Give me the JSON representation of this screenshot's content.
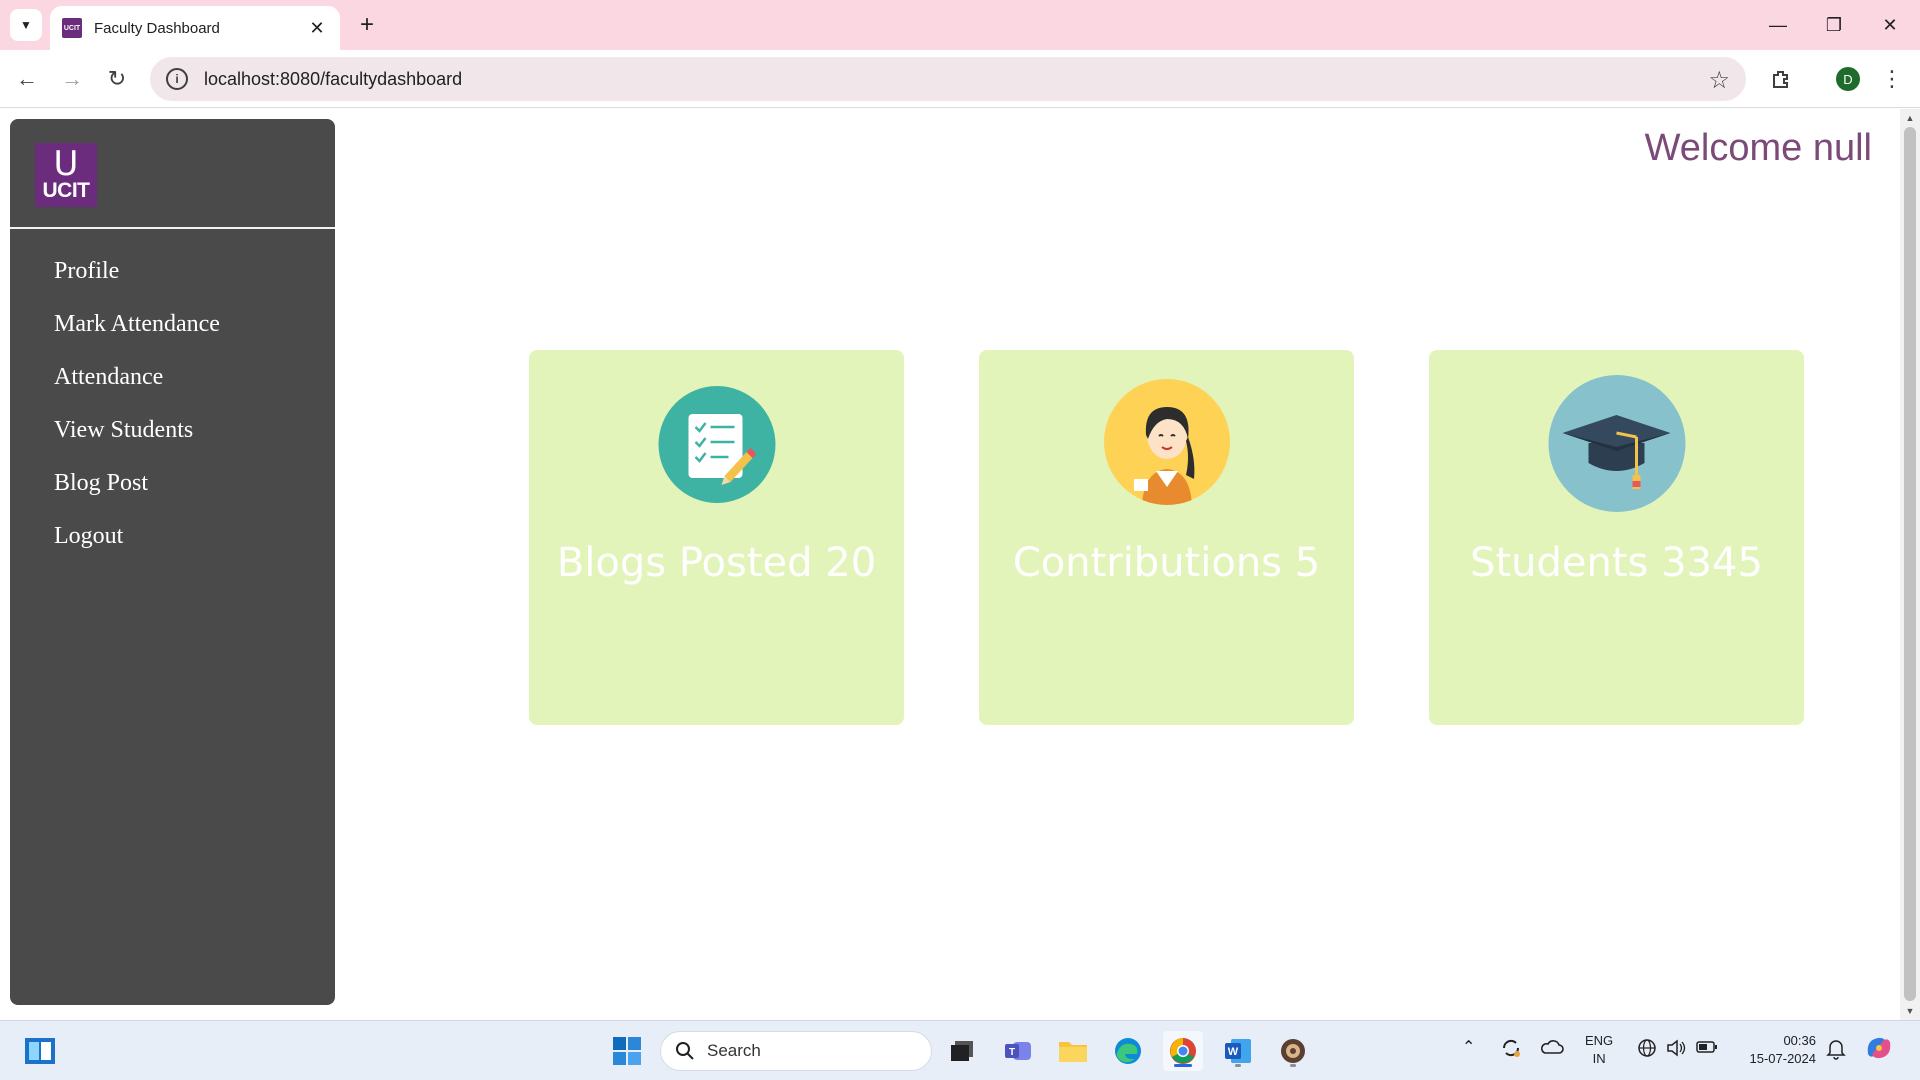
{
  "browser": {
    "tab_title": "Faculty Dashboard",
    "favicon_text": "UCIT",
    "url": "localhost:8080/facultydashboard",
    "profile_initial": "D"
  },
  "sidebar": {
    "logo_letter": "U",
    "logo_text": "UCIT",
    "items": [
      {
        "label": "Profile"
      },
      {
        "label": "Mark Attendance"
      },
      {
        "label": "Attendance"
      },
      {
        "label": "View Students"
      },
      {
        "label": "Blog Post"
      },
      {
        "label": "Logout"
      }
    ]
  },
  "header": {
    "welcome": "Welcome null"
  },
  "cards": [
    {
      "label": "Blogs Posted 20",
      "icon": "checklist-icon"
    },
    {
      "label": "Contributions 5",
      "icon": "person-avatar-icon"
    },
    {
      "label": "Students 3345",
      "icon": "graduation-cap-icon"
    }
  ],
  "taskbar": {
    "search_placeholder": "Search",
    "lang_line1": "ENG",
    "lang_line2": "IN",
    "time": "00:36",
    "date": "15-07-2024"
  },
  "colors": {
    "sidebar_bg": "#4a4a4a",
    "card_bg": "#e2f4ba",
    "welcome_text": "#7b4a78",
    "logo_bg": "#6b2c7d"
  }
}
